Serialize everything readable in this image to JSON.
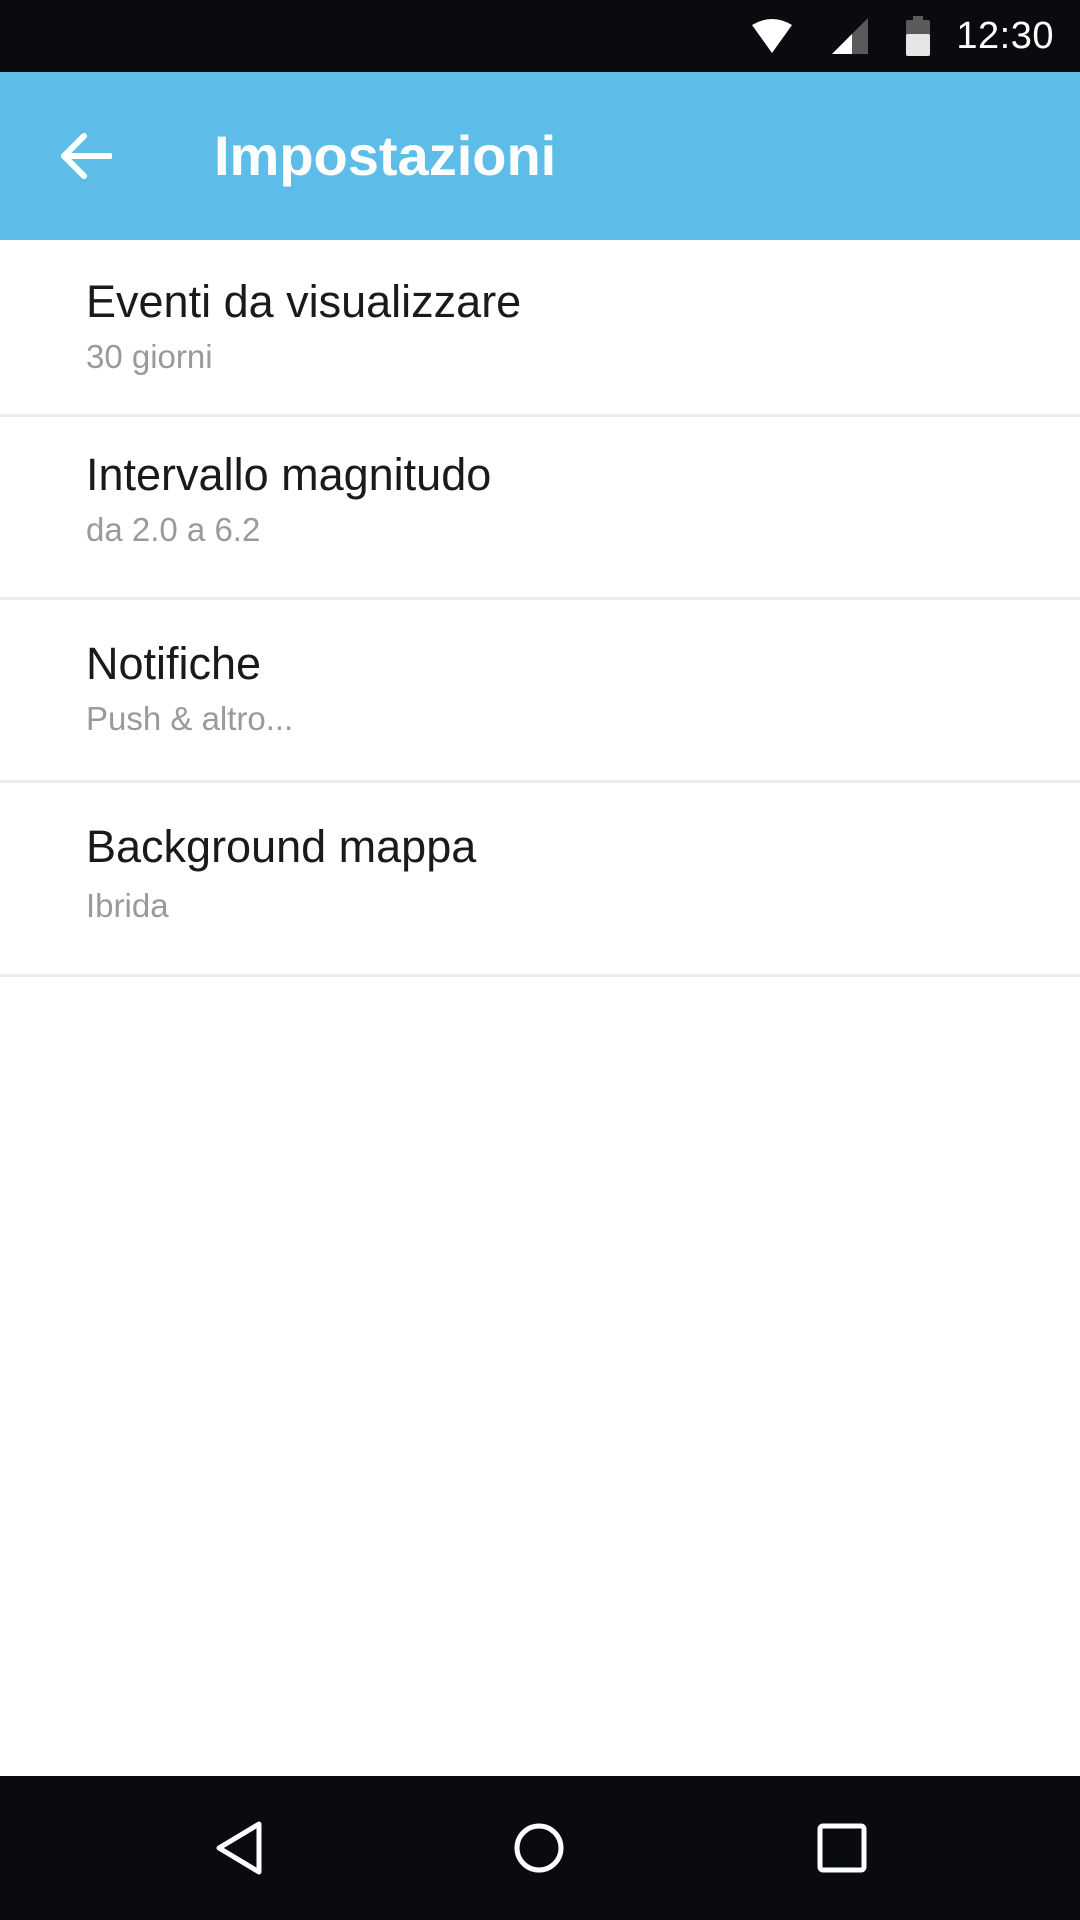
{
  "status_bar": {
    "time": "12:30",
    "icons": [
      "wifi-icon",
      "signal-icon",
      "battery-icon"
    ]
  },
  "app_bar": {
    "title": "Impostazioni",
    "back_icon": "arrow-back-icon",
    "color": "#5dbde8"
  },
  "settings": {
    "items": [
      {
        "title": "Eventi da visualizzare",
        "summary": "30 giorni"
      },
      {
        "title": "Intervallo magnitudo",
        "summary": "da 2.0 a 6.2"
      },
      {
        "title": "Notifiche",
        "summary": "Push & altro..."
      },
      {
        "title": "Background mappa",
        "summary": "Ibrida"
      }
    ]
  },
  "nav_bar": {
    "buttons": [
      "nav-back-icon",
      "nav-home-icon",
      "nav-recents-icon"
    ]
  },
  "colors": {
    "status_bar": "#0a0b0e",
    "title_text": "#1a1a1a",
    "summary_text": "#9a9a9a",
    "divider": "#ececec"
  }
}
